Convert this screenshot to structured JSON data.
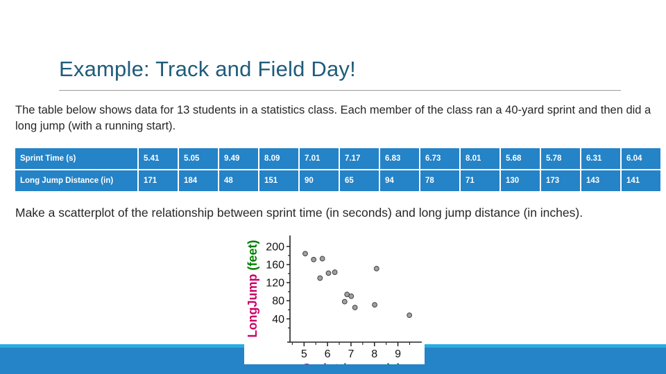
{
  "slide": {
    "title": "Example:  Track and Field Day!",
    "intro": "The table below shows data for 13 students in a statistics class.  Each member of the class ran a 40-yard sprint and then did a long jump (with a running start).",
    "prompt": "Make a scatterplot of the relationship between sprint time (in seconds) and long jump distance (in inches).",
    "colors": {
      "title": "#1F5C7A",
      "table_cell": "#2583C7",
      "band_light": "#2BACE2",
      "band_dark": "#2583C7",
      "body_text": "#262626"
    }
  },
  "table": {
    "rows": [
      {
        "header": "Sprint Time (s)",
        "values": [
          "5.41",
          "5.05",
          "9.49",
          "8.09",
          "7.01",
          "7.17",
          "6.83",
          "6.73",
          "8.01",
          "5.68",
          "5.78",
          "6.31",
          "6.04"
        ]
      },
      {
        "header": "Long Jump Distance (in)",
        "values": [
          "171",
          "184",
          "48",
          "151",
          "90",
          "65",
          "94",
          "78",
          "71",
          "130",
          "173",
          "143",
          "141"
        ]
      }
    ]
  },
  "chart_data": {
    "type": "scatter",
    "title": "",
    "xlabel_parts": [
      {
        "text": "Sprint",
        "color": "#CC0066"
      },
      {
        "text": "(seconds)",
        "color": "#008000"
      }
    ],
    "ylabel_parts": [
      {
        "text": "LongJump",
        "color": "#CC0066"
      },
      {
        "text": "(feet)",
        "color": "#008000"
      }
    ],
    "xlabel": "Sprint (seconds)",
    "ylabel": "LongJump (feet)",
    "xticks": [
      5,
      6,
      7,
      8,
      9
    ],
    "yticks": [
      40,
      80,
      120,
      160,
      200
    ],
    "xlim": [
      4.4,
      9.9
    ],
    "ylim": [
      10,
      215
    ],
    "grid": false,
    "legend": "none",
    "marker": {
      "fill": "#A0A0A0",
      "stroke": "#404040",
      "radius": 3.4
    },
    "x": [
      5.41,
      5.05,
      9.49,
      8.09,
      7.01,
      7.17,
      6.83,
      6.73,
      8.01,
      5.68,
      5.78,
      6.31,
      6.04
    ],
    "y": [
      171,
      184,
      48,
      151,
      90,
      65,
      94,
      78,
      71,
      130,
      173,
      143,
      141
    ],
    "points": [
      {
        "x": 5.05,
        "y": 184
      },
      {
        "x": 5.41,
        "y": 171
      },
      {
        "x": 5.78,
        "y": 173
      },
      {
        "x": 5.68,
        "y": 130
      },
      {
        "x": 6.04,
        "y": 141
      },
      {
        "x": 6.31,
        "y": 143
      },
      {
        "x": 6.73,
        "y": 78
      },
      {
        "x": 6.83,
        "y": 94
      },
      {
        "x": 7.01,
        "y": 90
      },
      {
        "x": 7.17,
        "y": 65
      },
      {
        "x": 8.01,
        "y": 71
      },
      {
        "x": 8.09,
        "y": 151
      },
      {
        "x": 9.49,
        "y": 48
      }
    ]
  }
}
